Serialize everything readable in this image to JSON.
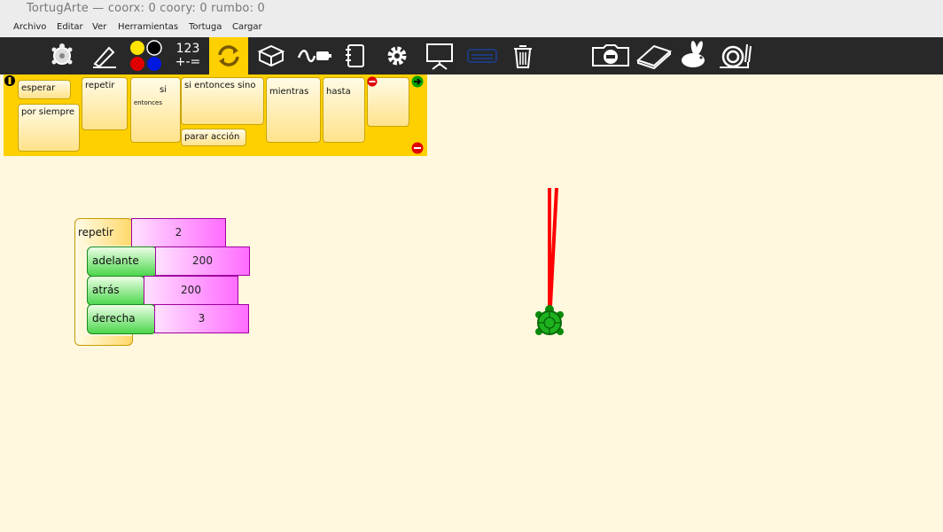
{
  "window": {
    "title": "TortugArte — coorx: 0 coory: 0 rumbo: 0"
  },
  "menu": {
    "items": [
      "Archivo",
      "Editar",
      "Ver",
      "Herramientas",
      "Tortuga",
      "Cargar"
    ]
  },
  "toolbar": {
    "number_label_top": "123",
    "number_label_bottom": "+-=",
    "icons": [
      "turtle-icon",
      "pen-icon",
      "colors-icon",
      "numbers-icon",
      "flow-icon",
      "boxes-icon",
      "sensors-icon",
      "notebook-icon",
      "settings-icon",
      "presentation-icon",
      "extras-icon",
      "trash-icon",
      "stop-icon",
      "eraser-icon",
      "rabbit-icon",
      "snail-icon"
    ],
    "accent_color": "#ffd000"
  },
  "palette": {
    "blocks": {
      "wait": "esperar",
      "forever": "por siempre",
      "repeat": "repetir",
      "if": "si",
      "then": "entonces",
      "if_then_else": "si entonces sino",
      "stop_action": "parar acción",
      "while": "mientras",
      "until": "hasta"
    }
  },
  "program": {
    "repeat_label": "repetir",
    "repeat_value": "2",
    "forward_label": "adelante",
    "forward_value": "200",
    "back_label": "atrás",
    "back_value": "200",
    "right_label": "derecha",
    "right_value": "3"
  },
  "colors": {
    "pen": "#ff0000",
    "turtle": "#0a8a0a",
    "canvas": "#fff8de"
  }
}
